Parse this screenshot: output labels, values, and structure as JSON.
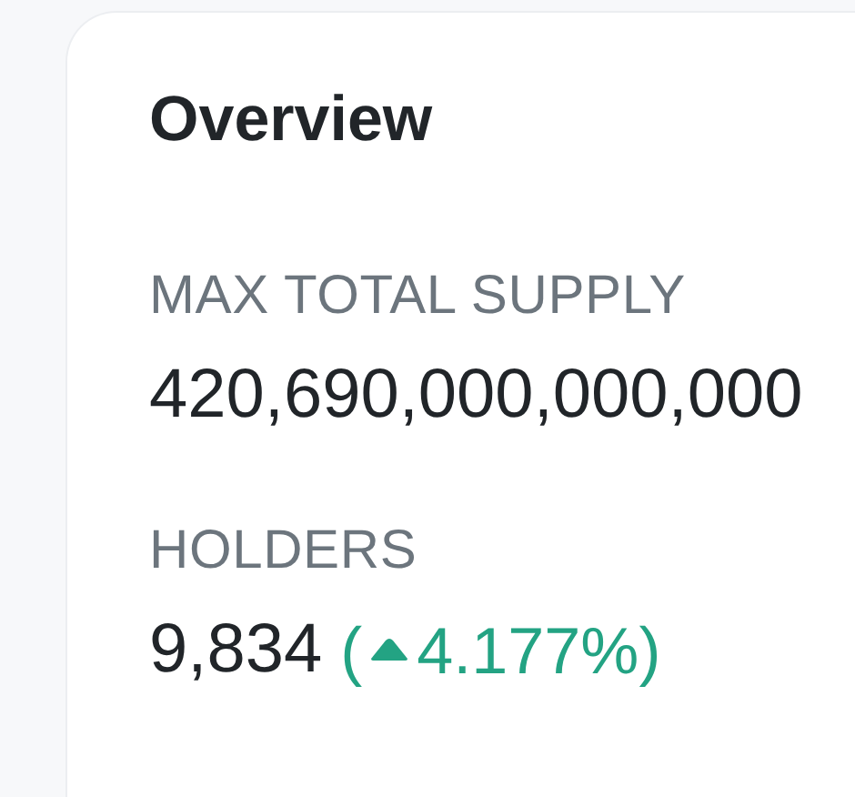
{
  "card": {
    "title": "Overview",
    "stats": [
      {
        "label": "MAX TOTAL SUPPLY",
        "value": "420,690,000,000,000"
      },
      {
        "label": "HOLDERS",
        "value": "9,834",
        "change": {
          "open": "(",
          "rising": true,
          "value": "4.177%",
          "close": ")"
        }
      }
    ]
  }
}
